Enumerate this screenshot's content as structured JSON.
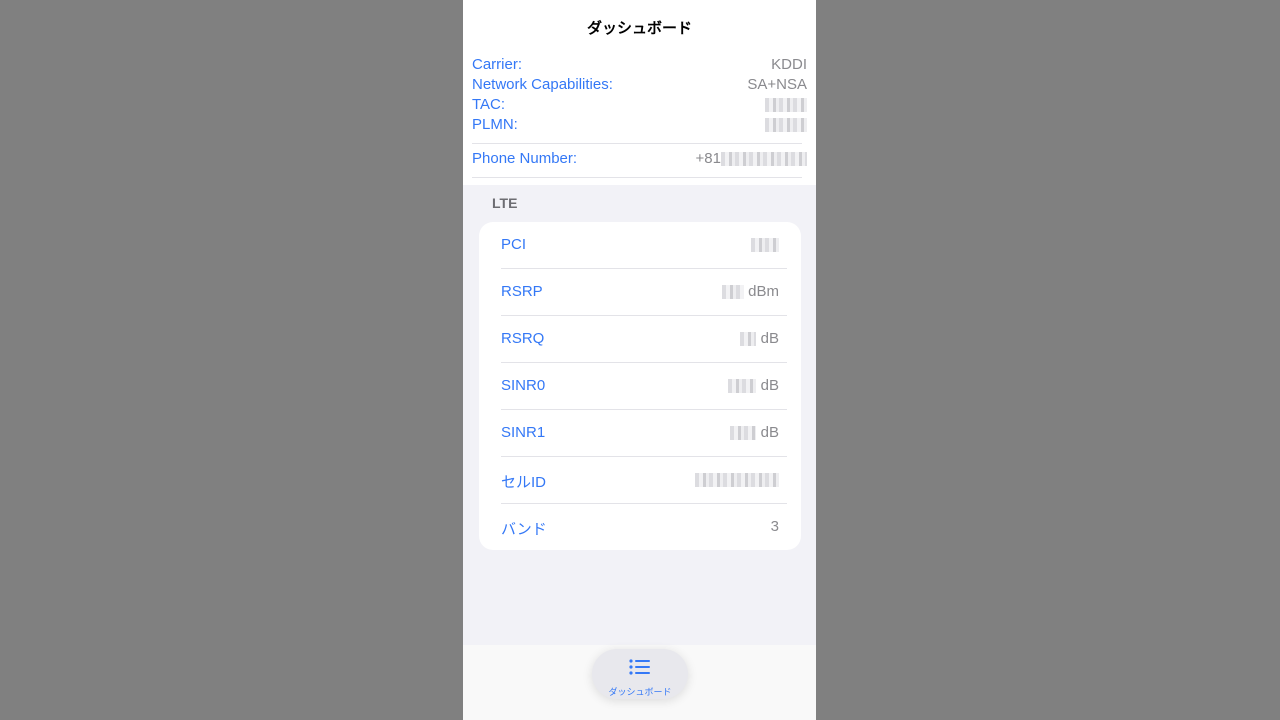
{
  "header": {
    "title": "ダッシュボード"
  },
  "info": {
    "carrier": {
      "label": "Carrier:",
      "value": "KDDI"
    },
    "network": {
      "label": "Network Capabilities:",
      "value": "SA+NSA"
    },
    "tac": {
      "label": "TAC:"
    },
    "plmn": {
      "label": "PLMN:"
    },
    "phone": {
      "label": "Phone Number:",
      "prefix": "+81"
    }
  },
  "lte": {
    "section_title": "LTE",
    "rows": [
      {
        "label": "PCI",
        "unit": ""
      },
      {
        "label": "RSRP",
        "unit": "dBm"
      },
      {
        "label": "RSRQ",
        "unit": "dB"
      },
      {
        "label": "SINR0",
        "unit": "dB"
      },
      {
        "label": "SINR1",
        "unit": "dB"
      },
      {
        "label": "セルID",
        "unit": ""
      },
      {
        "label": "バンド",
        "value": "3"
      }
    ]
  },
  "tabbar": {
    "dashboard_label": "ダッシュボード",
    "icon": "list-icon"
  },
  "colors": {
    "accent": "#3478f6",
    "secondary_text": "#8a8a8e",
    "background": "#f2f2f7"
  }
}
